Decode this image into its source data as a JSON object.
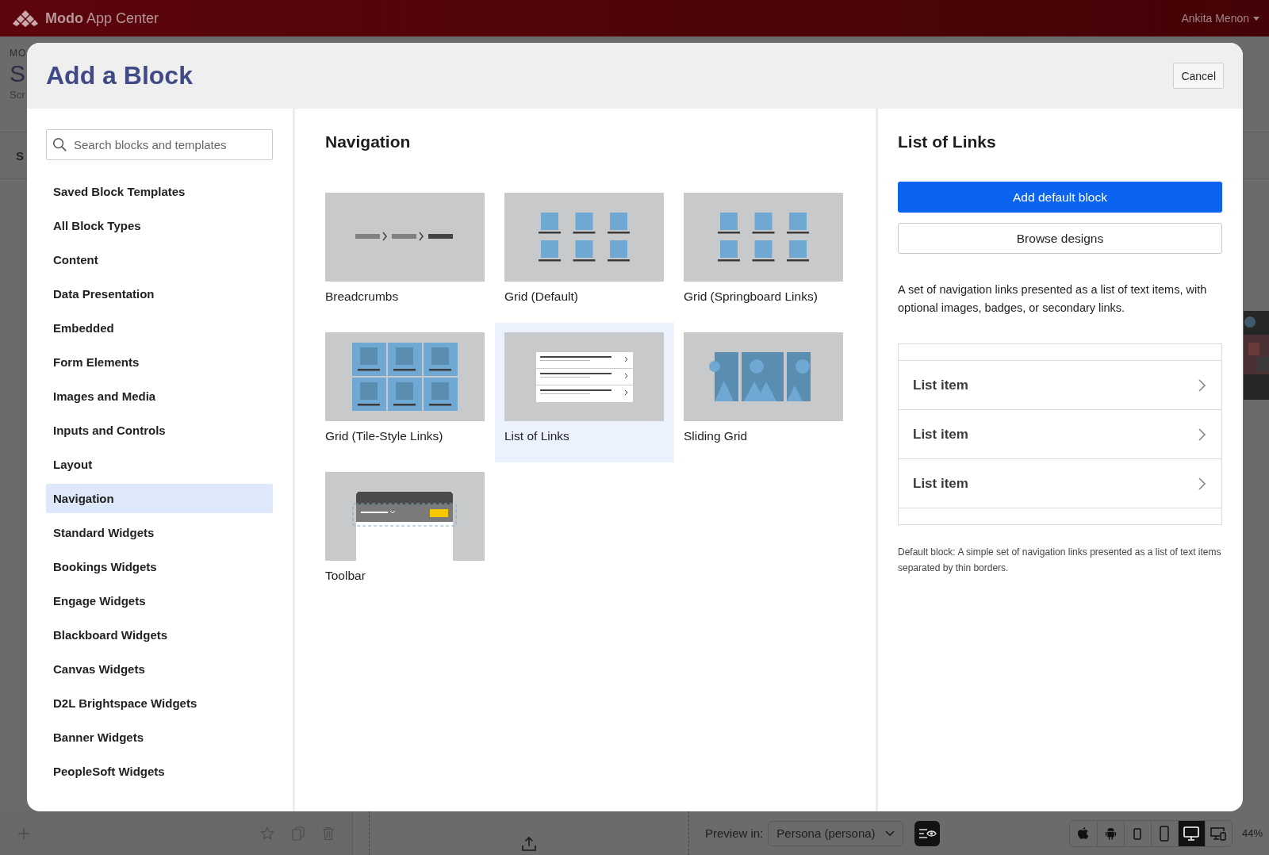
{
  "app_bar": {
    "brand_bold": "Modo",
    "brand_rest": "App Center",
    "user": "Ankita Menon"
  },
  "background_page": {
    "breadcrumb": "MO",
    "title": "S",
    "subtitle": "Scr",
    "tab": "S"
  },
  "bottom_bar": {
    "preview_label": "Preview in:",
    "persona": "Persona (persona)",
    "devices": [
      {
        "kind": "apple",
        "selected": false
      },
      {
        "kind": "android",
        "selected": false
      },
      {
        "kind": "small-phone",
        "selected": false
      },
      {
        "kind": "phone",
        "selected": false
      },
      {
        "kind": "desktop",
        "selected": true
      },
      {
        "kind": "tablet-desktop",
        "selected": false
      }
    ],
    "zoom": "44%"
  },
  "dialog": {
    "title": "Add a Block",
    "cancel": "Cancel",
    "search_placeholder": "Search blocks and templates",
    "categories": [
      {
        "label": "Saved Block Templates",
        "selected": false
      },
      {
        "label": "All Block Types",
        "selected": false
      },
      {
        "label": "Content",
        "selected": false
      },
      {
        "label": "Data Presentation",
        "selected": false
      },
      {
        "label": "Embedded",
        "selected": false
      },
      {
        "label": "Form Elements",
        "selected": false
      },
      {
        "label": "Images and Media",
        "selected": false
      },
      {
        "label": "Inputs and Controls",
        "selected": false
      },
      {
        "label": "Layout",
        "selected": false
      },
      {
        "label": "Navigation",
        "selected": true
      },
      {
        "label": "Standard Widgets",
        "selected": false
      },
      {
        "label": "Bookings Widgets",
        "selected": false
      },
      {
        "label": "Engage Widgets",
        "selected": false
      },
      {
        "label": "Blackboard Widgets",
        "selected": false
      },
      {
        "label": "Canvas Widgets",
        "selected": false
      },
      {
        "label": "D2L Brightspace Widgets",
        "selected": false
      },
      {
        "label": "Banner Widgets",
        "selected": false
      },
      {
        "label": "PeopleSoft Widgets",
        "selected": false
      }
    ],
    "section_title": "Navigation",
    "blocks": [
      {
        "label": "Breadcrumbs",
        "kind": "breadcrumbs",
        "selected": false
      },
      {
        "label": "Grid (Default)",
        "kind": "grid",
        "selected": false
      },
      {
        "label": "Grid (Springboard Links)",
        "kind": "grid",
        "selected": false
      },
      {
        "label": "Grid (Tile-Style Links)",
        "kind": "tiles",
        "selected": false
      },
      {
        "label": "List of Links",
        "kind": "list",
        "selected": true
      },
      {
        "label": "Sliding Grid",
        "kind": "sliding",
        "selected": false
      },
      {
        "label": "Toolbar",
        "kind": "toolbar",
        "selected": false
      }
    ],
    "details": {
      "title": "List of Links",
      "primary_button": "Add default block",
      "secondary_button": "Browse designs",
      "description": "A set of navigation links presented as a list of text items, with optional images, badges, or secondary links.",
      "preview_items": [
        "List item",
        "List item",
        "List item"
      ],
      "note": "Default block: A simple set of navigation links presented as a list of text items separated by thin borders."
    }
  }
}
